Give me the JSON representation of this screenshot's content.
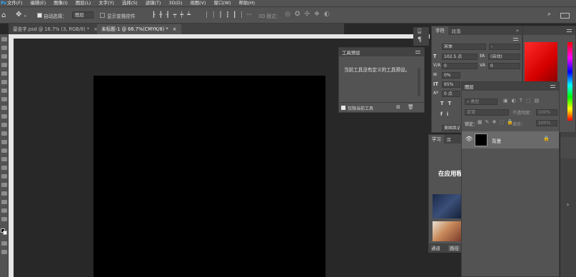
{
  "menu": {
    "logo": "Ps",
    "items": [
      "文件(F)",
      "编辑(E)",
      "图像(I)",
      "图层(L)",
      "文字(Y)",
      "选择(S)",
      "滤镜(T)",
      "3D(D)",
      "视图(V)",
      "窗口(W)",
      "帮助(H)"
    ]
  },
  "options": {
    "auto_select_label": "自动选择：",
    "layer_dropdown": "图层",
    "show_transform_label": "显示变换控件",
    "mode_3d_label": "3D 模式："
  },
  "tabs": [
    {
      "label": "鎏金字.psd @ 16.7% (3, RGB/8) *",
      "close": "×"
    },
    {
      "label": "未标题-1 @ 66.7%(CMYK/8) *",
      "close": "×"
    }
  ],
  "tool_preset": {
    "title": "工具预设",
    "message": "当前工具没有定义的工具预设。",
    "current_tool_only": "仅限当前工具"
  },
  "character": {
    "tabs": [
      "字符",
      "段落"
    ],
    "font_family": "宋体",
    "font_style": "-",
    "font_size": "102.5 点",
    "leading": "(自动)",
    "kerning": "0",
    "tracking": "0",
    "vertical_scale": "0%",
    "horizontal_scale": "95%",
    "baseline_shift": "0 点",
    "language": "美国英语"
  },
  "layers": {
    "title": "图层",
    "search": "类型",
    "blend_mode": "正常",
    "opacity_label": "不透明度：",
    "opacity": "100%",
    "lock_label": "锁定：",
    "fill_label": "填充：",
    "fill": "100%",
    "layer_name": "背景"
  },
  "learn": {
    "tabs": [
      "学习",
      "库"
    ],
    "heading": "在应用程"
  },
  "bottom_tabs": [
    "通道",
    "路径"
  ],
  "colors": {
    "accent": "#31a8ff",
    "panel_bg": "#535353",
    "canvas_bg": "#282828",
    "swatch_red": "#e00000"
  }
}
